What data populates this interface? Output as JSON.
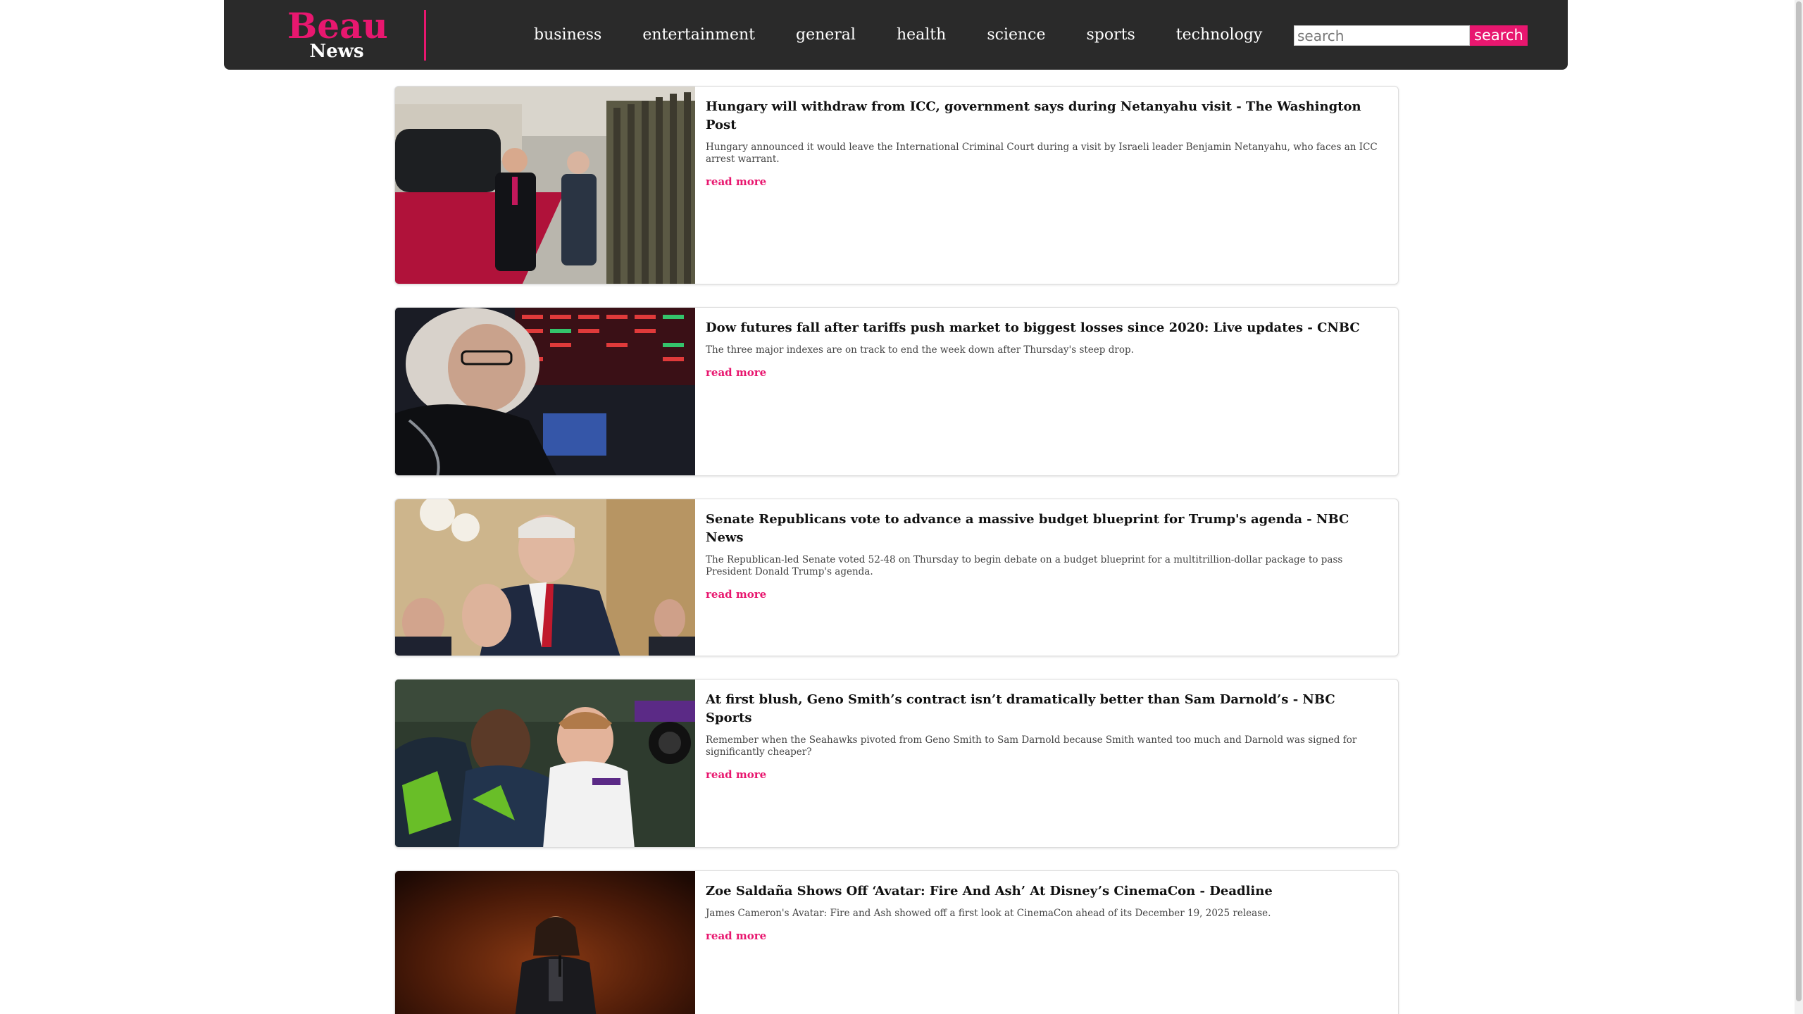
{
  "brand": {
    "name_top": "Beau",
    "name_bottom": "News",
    "accent_color": "#e8176f",
    "header_color": "#2a2a2a"
  },
  "nav": {
    "items": [
      {
        "label": "business"
      },
      {
        "label": "entertainment"
      },
      {
        "label": "general"
      },
      {
        "label": "health"
      },
      {
        "label": "science"
      },
      {
        "label": "sports"
      },
      {
        "label": "technology"
      }
    ]
  },
  "search": {
    "placeholder": "search",
    "value": "",
    "button_label": "search"
  },
  "articles": [
    {
      "title": "Hungary will withdraw from ICC, government says during Netanyahu visit - The Washington Post",
      "description": "Hungary announced it would leave the International Criminal Court during a visit by Israeli leader Benjamin Netanyahu, who faces an ICC arrest warrant.",
      "read_more": "read more",
      "image": "photo-two-leaders-walking-red-carpet-honor-guard"
    },
    {
      "title": "Dow futures fall after tariffs push market to biggest losses since 2020: Live updates - CNBC",
      "description": "The three major indexes are on track to end the week down after Thursday's steep drop.",
      "read_more": "read more",
      "image": "photo-trader-on-stock-exchange-floor"
    },
    {
      "title": "Senate Republicans vote to advance a massive budget blueprint for Trump's agenda - NBC News",
      "description": "The Republican-led Senate voted 52-48 on Thursday to begin debate on a budget blueprint for a multitrillion-dollar package to pass President Donald Trump's agenda.",
      "read_more": "read more",
      "image": "photo-senator-speaking-in-capitol"
    },
    {
      "title": "At first blush, Geno Smith’s contract isn’t dramatically better than Sam Darnold’s - NBC Sports",
      "description": "Remember when the Seahawks pivoted from Geno Smith to Sam Darnold because Smith wanted too much and Darnold was signed for significantly cheaper?",
      "read_more": "read more",
      "image": "photo-football-players-embracing-after-game"
    },
    {
      "title": "Zoe Saldaña Shows Off ‘Avatar: Fire And Ash’ At Disney’s CinemaCon - Deadline",
      "description": "James Cameron's Avatar: Fire and Ash showed off a first look at CinemaCon ahead of its December 19, 2025 release.",
      "read_more": "read more",
      "image": "photo-actress-speaking-on-stage"
    }
  ]
}
